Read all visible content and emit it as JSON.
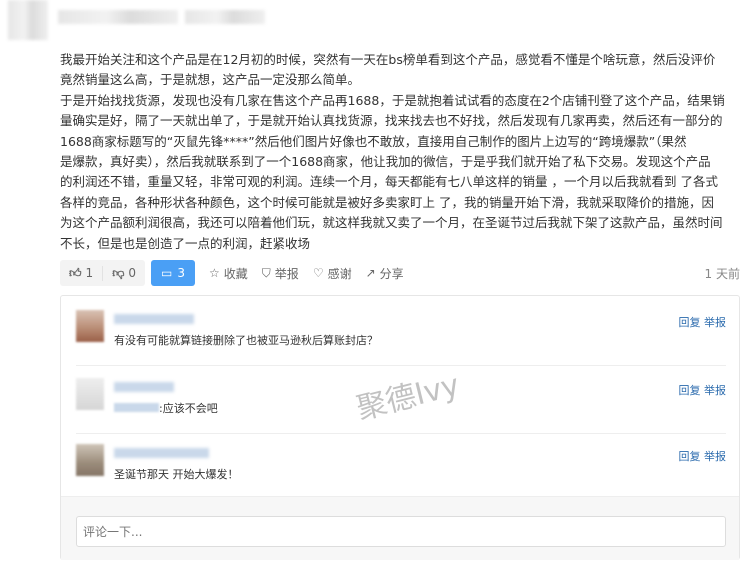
{
  "post": {
    "paragraphs": [
      [
        "我最开始关注和这个产品是在12月初的时候，突然有一天在bs榜单看到这个产品，感觉看不懂是个啥玩意，然后没评价",
        "竟然销量这么高，于是就想，这产品一定没那么简单。"
      ],
      [
        "于是开始找找货源，发现也没有几家在售这个产品再1688，于是就抱着试试看的态度在2个店铺刊登了这个产品，结果销",
        "量确实是好，隔了一天就出单了，于是就开始认真找货源，找来找去也不好找，然后发现有几家再卖，然后还有一部分的",
        "1688商家标题写的“灭鼠先锋****”然后他们图片好像也不敢放，直接用自己制作的图片上边写的“跨境爆款”（果然",
        "是爆款，真好卖），然后我就联系到了一个1688商家，他让我加的微信，于是乎我们就开始了私下交易。发现这个产品",
        "的利润还不错，重量又轻，非常可观的利润。连续一个月，每天都能有七八单这样的销量 ，一个月以后我就看到 了各式",
        "各样的竞品，各种形状各种颜色，这个时候可能就是被好多卖家盯上 了，我的销量开始下滑，我就采取降价的措施，因",
        "为这个产品额利润很高，我还可以陪着他们玩，就这样我就又卖了一个月，在圣诞节过后我就下架了这款产品，虽然时间",
        "不长，但是也是创造了一点的利润，赶紧收场"
      ]
    ]
  },
  "actions": {
    "like_count": "1",
    "dislike_count": "0",
    "comment_count": "3",
    "collect": "收藏",
    "report": "举报",
    "thanks": "感谢",
    "share": "分享",
    "time": "1 天前"
  },
  "comments": [
    {
      "text": "有没有可能就算链接删除了也被亚马逊秋后算账封店？",
      "reply": "回复",
      "report": "举报"
    },
    {
      "text": ":应该不会吧",
      "reply": "回复",
      "report": "举报"
    },
    {
      "text": "圣诞节那天 开始大爆发！",
      "reply": "回复",
      "report": "举报"
    }
  ],
  "comment_input": {
    "placeholder": "评论一下..."
  },
  "watermark": "聚德Ivy",
  "colors": {
    "accent": "#4a9ff5",
    "link": "#2a6aad"
  }
}
